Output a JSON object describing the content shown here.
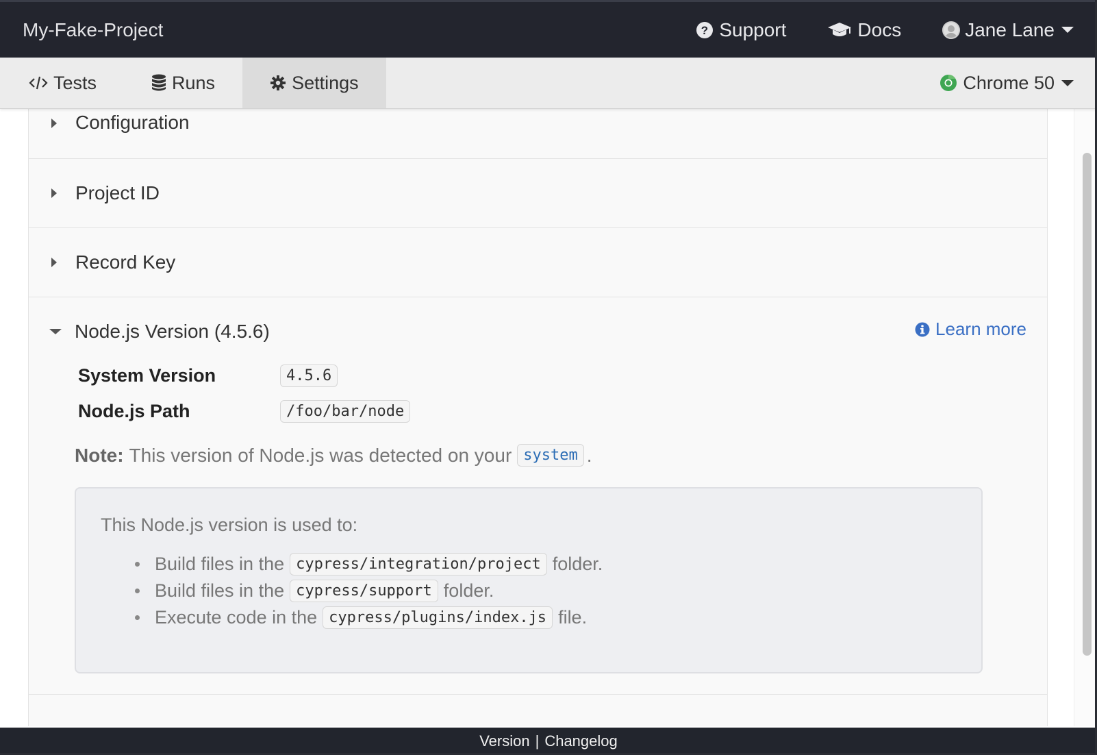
{
  "header": {
    "project_name": "My-Fake-Project",
    "support_label": "Support",
    "docs_label": "Docs",
    "user_name": "Jane Lane"
  },
  "tabs": [
    {
      "label": "Tests",
      "icon": "code-icon"
    },
    {
      "label": "Runs",
      "icon": "database-icon"
    },
    {
      "label": "Settings",
      "icon": "gear-icon",
      "active": true
    }
  ],
  "browser": {
    "label": "Chrome 50",
    "icon": "chrome-icon"
  },
  "sections": {
    "configuration": "Configuration",
    "project_id": "Project ID",
    "record_key": "Record Key",
    "node_version": "Node.js Version (4.5.6)"
  },
  "node": {
    "learn_more": "Learn more",
    "system_version_label": "System Version",
    "system_version_value": "4.5.6",
    "path_label": "Node.js Path",
    "path_value": "/foo/bar/node",
    "note_label": "Note:",
    "note_text": "This version of Node.js was detected on your",
    "note_code": "system",
    "note_end": ".",
    "info_lead": "This Node.js version is used to:",
    "uses": [
      {
        "prefix": "Build files in the",
        "code": "cypress/integration/project",
        "suffix": "folder."
      },
      {
        "prefix": "Build files in the",
        "code": "cypress/support",
        "suffix": "folder."
      },
      {
        "prefix": "Execute code in the",
        "code": "cypress/plugins/index.js",
        "suffix": "file."
      }
    ]
  },
  "footer": {
    "version_label": "Version",
    "separator": "|",
    "changelog_label": "Changelog"
  },
  "colors": {
    "header_bg": "#23252e",
    "tabbar_bg": "#ececec",
    "link": "#3a6fc4",
    "chrome_green": "#3fa652"
  }
}
